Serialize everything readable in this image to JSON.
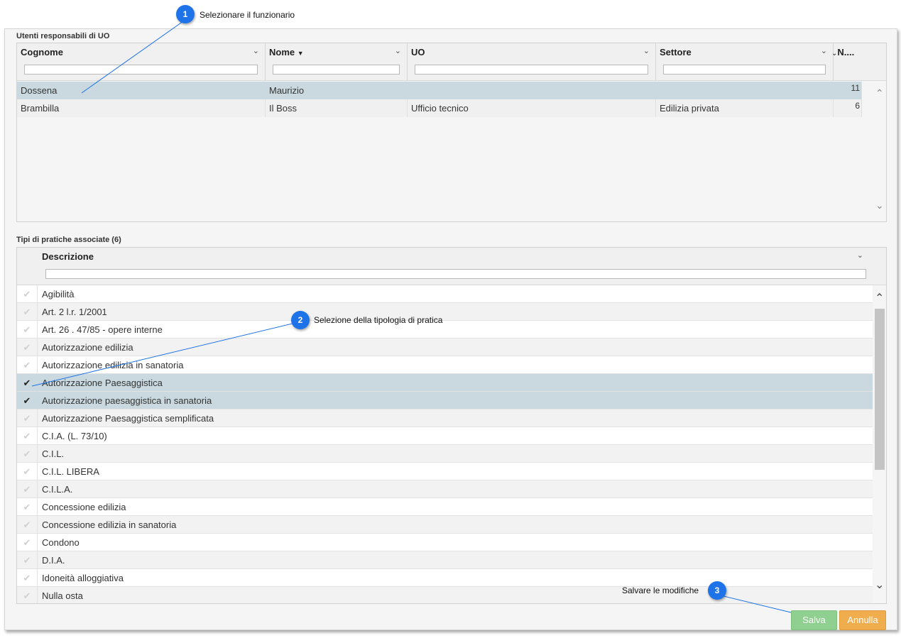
{
  "users_section": {
    "title": "Utenti responsabili di UO",
    "columns": [
      {
        "label": "Cognome"
      },
      {
        "label": "Nome",
        "sort": "▼"
      },
      {
        "label": "UO"
      },
      {
        "label": "Settore"
      },
      {
        "label": "N...."
      }
    ],
    "rows": [
      {
        "cognome": "Dossena",
        "nome": "Maurizio",
        "uo": "",
        "settore": "",
        "n": "11"
      },
      {
        "cognome": "Brambilla",
        "nome": "Il Boss",
        "uo": "Ufficio tecnico",
        "settore": "Edilizia privata",
        "n": "6"
      }
    ]
  },
  "types_section": {
    "title": "Tipi di pratiche associate (6)",
    "column": "Descrizione",
    "items": [
      {
        "label": "Agibilità",
        "checked": false
      },
      {
        "label": "Art. 2 l.r. 1/2001",
        "checked": false
      },
      {
        "label": "Art. 26 . 47/85 - opere interne",
        "checked": false
      },
      {
        "label": "Autorizzazione edilizia",
        "checked": false
      },
      {
        "label": "Autorizzazione edilizia in sanatoria",
        "checked": false
      },
      {
        "label": "Autorizzazione Paesaggistica",
        "checked": true
      },
      {
        "label": "Autorizzazione paesaggistica in sanatoria",
        "checked": true
      },
      {
        "label": "Autorizzazione Paesaggistica semplificata",
        "checked": false
      },
      {
        "label": "C.I.A. (L. 73/10)",
        "checked": false
      },
      {
        "label": "C.I.L.",
        "checked": false
      },
      {
        "label": "C.I.L. LIBERA",
        "checked": false
      },
      {
        "label": "C.I.L.A.",
        "checked": false
      },
      {
        "label": "Concessione edilizia",
        "checked": false
      },
      {
        "label": "Concessione edilizia in sanatoria",
        "checked": false
      },
      {
        "label": "Condono",
        "checked": false
      },
      {
        "label": "D.I.A.",
        "checked": false
      },
      {
        "label": "Idoneità alloggiativa",
        "checked": false
      },
      {
        "label": "Nulla osta",
        "checked": false
      }
    ]
  },
  "buttons": {
    "save": "Salva",
    "cancel": "Annulla"
  },
  "callouts": [
    {
      "number": "1",
      "text": "Selezionare il funzionario"
    },
    {
      "number": "2",
      "text": "Selezione della tipologia di pratica"
    },
    {
      "number": "3",
      "text": "Salvare le modifiche"
    }
  ],
  "colors": {
    "callout": "#1e73e8",
    "save_button": "#8fcf8f",
    "cancel_button": "#f0ad4e",
    "selected_row": "#c9d9df"
  }
}
